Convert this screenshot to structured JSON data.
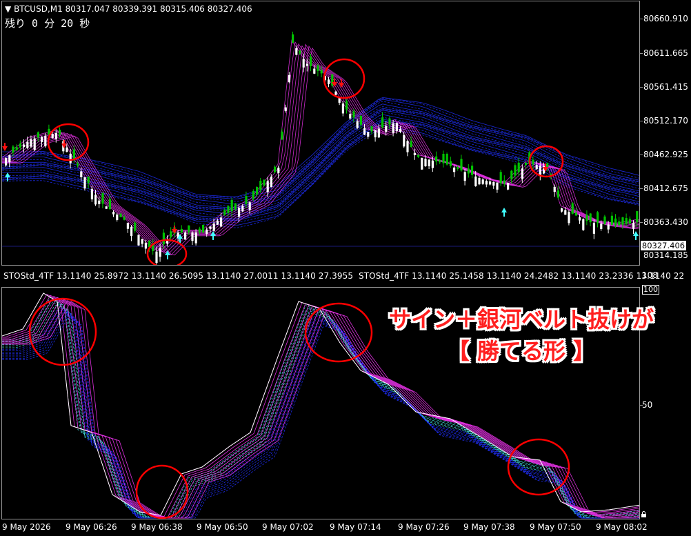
{
  "chart_header": {
    "symbol": "BTCUSD,M1",
    "ohlc": "80317.047 80339.391 80315.406 80327.406",
    "countdown": "残り 0 分 20 秒"
  },
  "price_scale": {
    "labels": [
      "80660.910",
      "80611.665",
      "80561.415",
      "80512.170",
      "80462.925",
      "80412.675",
      "80363.430",
      "80314.185"
    ],
    "current_price": "80327.406"
  },
  "indicator": {
    "header_1": "STOStd_4TF 13.1140 25.8972 13.1140 26.5095 13.1140 27.0011 13.1140 27.3955",
    "header_2": "STOStd_4TF 13.1140 25.1458 13.1140 24.2482 13.1140 23.2336 13.1140 22",
    "scale": {
      "top_outside": "108",
      "top_boxed": "100",
      "mid": "50"
    }
  },
  "time_axis": [
    "9 May 2026",
    "9 May 06:26",
    "9 May 06:38",
    "9 May 06:50",
    "9 May 07:02",
    "9 May 07:14",
    "9 May 07:26",
    "9 May 07:38",
    "9 May 07:50",
    "9 May 08:02"
  ],
  "annotation": {
    "line_1": "サイン＋銀河ベルト抜けが",
    "line_2": "【 勝てる形 】"
  },
  "colors": {
    "bull_candle": "#00c400",
    "bear_candle": "#ffffff",
    "ribbon_magenta": "#e030e0",
    "ribbon_blue": "#2030ff",
    "stoch_cyan": "#40e0e0",
    "sell_arrow": "#ff1010",
    "buy_arrow": "#40ffff",
    "circle": "#ff0000",
    "annotation_text": "#ff1f1f"
  }
}
